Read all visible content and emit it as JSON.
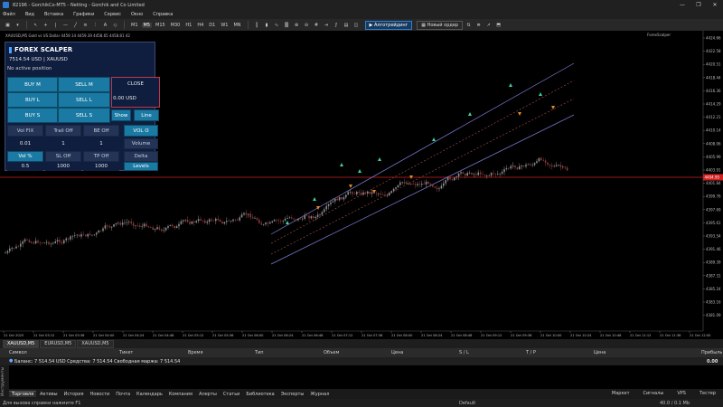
{
  "window": {
    "title": "82196 - GorchikCo-MT5 - Netting - Gorchik and Co Limited",
    "controls": [
      "—",
      "❐",
      "✕"
    ]
  },
  "menu": [
    "Файл",
    "Вид",
    "Вставка",
    "Графики",
    "Сервис",
    "Окно",
    "Справка"
  ],
  "toolbar": {
    "timeframes": [
      "M1",
      "M5",
      "M15",
      "M30",
      "H1",
      "H4",
      "D1",
      "W1",
      "MN"
    ],
    "active_tf": "M5",
    "algo_label": "Алготрейдинг",
    "neworder_label": "Новый ордер"
  },
  "chart": {
    "symbol_line": "XAUUSD,M5  Gold vs US Dollar   4459.14 4459.39 4458.65 4458.81 42",
    "indicator_name": "ForexScalper",
    "price_labels": [
      "4424.66",
      "4422.58",
      "4420.51",
      "4418.44",
      "4416.36",
      "4414.29",
      "4412.21",
      "4410.14",
      "4408.06",
      "4405.99",
      "4403.91",
      "4401.84",
      "4399.76",
      "4397.69",
      "4395.61",
      "4393.54",
      "4391.46",
      "4389.39",
      "4387.31",
      "4385.24",
      "4383.16",
      "4381.09"
    ],
    "current_price": "4404.95",
    "time_labels": [
      "21 Oct 2025",
      "21 Oct 03:12",
      "21 Oct 03:36",
      "21 Oct 04:00",
      "21 Oct 04:24",
      "21 Oct 04:48",
      "21 Oct 05:12",
      "21 Oct 05:36",
      "21 Oct 06:00",
      "21 Oct 06:24",
      "21 Oct 06:48",
      "21 Oct 07:12",
      "21 Oct 07:36",
      "21 Oct 08:00",
      "21 Oct 08:24",
      "21 Oct 08:48",
      "21 Oct 09:12",
      "21 Oct 09:36",
      "21 Oct 10:00",
      "21 Oct 10:24",
      "21 Oct 10:48",
      "21 Oct 11:12",
      "21 Oct 11:36",
      "21 Oct 12:00"
    ],
    "colors": {
      "bull": "#8c8c8c",
      "bear": "#8a3a3a",
      "channel": "#7d7dd8",
      "hline": "#d02020",
      "buy_arrow": "#3fd0a0",
      "sell_arrow": "#e08a30"
    }
  },
  "panel": {
    "title": "FOREX SCALPER",
    "balance": "7514.54 USD | XAUUSD",
    "position": "No active position",
    "buy_m": "BUY M",
    "sell_m": "SELL M",
    "close": "CLOSE",
    "buy_l": "BUY L",
    "sell_l": "SELL L",
    "close_value": "0.00 USD",
    "buy_s": "BUY S",
    "sell_s": "SELL S",
    "show": "Show",
    "line": "Line",
    "vol_fix": "Vol FIX",
    "trail_off": "Trail Off",
    "be_off": "BE Off",
    "vol_o": "VOL O",
    "v1": "0.01",
    "v2": "1",
    "v3": "1",
    "volume": "Volume",
    "vol_pct": "Vol %",
    "sl_off": "SL Off",
    "tp_off": "TP Off",
    "delta": "Delta",
    "v4": "0.5",
    "v5": "1000",
    "v6": "1000",
    "levels": "Levels"
  },
  "chart_tabs": [
    "XAUUSD,M5",
    "EURUSD,M5",
    "XAUUSD,M5"
  ],
  "trade_headers": {
    "symbol": "Символ",
    "ticket": "Тикет",
    "time": "Время",
    "type": "Тип",
    "volume": "Объем",
    "price": "Цена",
    "sl": "S / L",
    "tp": "T / P",
    "price2": "Цена",
    "profit": "Прибыль"
  },
  "balance_line": "Баланс: 7 514.54 USD  Средства: 7 514.54  Свободная маржа: 7 514.54",
  "balance_profit": "0.00",
  "terminal_side": "Инструменты",
  "terminal_tabs": [
    "Торговля",
    "Активы",
    "История",
    "Новости",
    "Почта",
    "Календарь",
    "Компания",
    "Алерты",
    "Статьи",
    "Библиотека",
    "Эксперты",
    "Журнал"
  ],
  "terminal_right": [
    "Маркет",
    "Сигналы",
    "VPS",
    "Тестер"
  ],
  "status": {
    "help": "Для вызова справки нажмите F1",
    "profile": "Default",
    "ping": "40.0 / 0.1 Mb"
  }
}
